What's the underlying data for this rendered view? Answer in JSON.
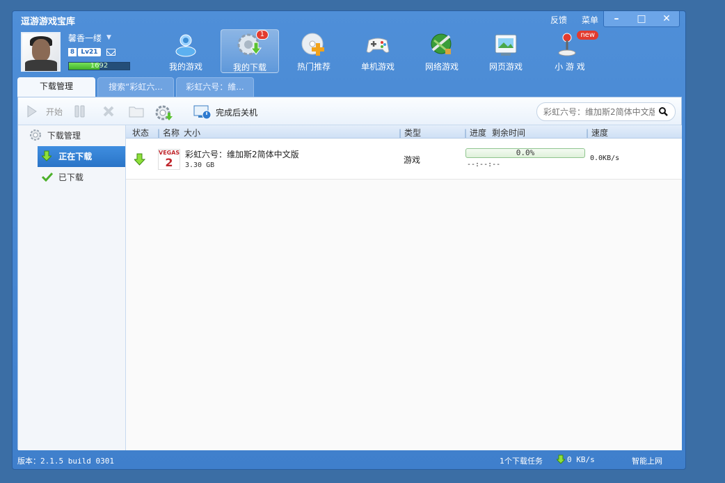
{
  "app": {
    "title": "逗游游戏宝库"
  },
  "titlebar": {
    "feedback": "反馈",
    "menu": "菜单"
  },
  "user": {
    "name": "馨香一缕",
    "level": "Lv21",
    "lv_icon": "8",
    "exp": "1692",
    "exp_progress": 0.5
  },
  "nav": {
    "items": [
      {
        "label": "我的游戏",
        "icon": "my-games-icon"
      },
      {
        "label": "我的下载",
        "icon": "my-downloads-icon",
        "badge": "1"
      },
      {
        "label": "热门推荐",
        "icon": "hot-recommend-icon"
      },
      {
        "label": "单机游戏",
        "icon": "single-player-games-icon"
      },
      {
        "label": "网络游戏",
        "icon": "online-games-icon"
      },
      {
        "label": "网页游戏",
        "icon": "web-games-icon"
      },
      {
        "label": "小 游 戏",
        "icon": "mini-games-icon",
        "badge": "new"
      }
    ]
  },
  "tabs": [
    {
      "label": "下载管理"
    },
    {
      "label": "搜索“彩虹六..."
    },
    {
      "label": "彩虹六号：維..."
    }
  ],
  "toolbar": {
    "start": "开始",
    "shutdown_after": "完成后关机"
  },
  "search": {
    "placeholder": "彩虹六号：维加斯2简体中文版"
  },
  "sidebar": {
    "header": "下载管理",
    "items": [
      {
        "label": "正在下载"
      },
      {
        "label": "已下载"
      }
    ]
  },
  "table": {
    "columns": {
      "status": "状态",
      "name": "名称",
      "size": "大小",
      "type": "类型",
      "progress": "进度",
      "remaining": "剩余时间",
      "speed": "速度"
    },
    "rows": [
      {
        "name": "彩虹六号：维加斯2简体中文版",
        "size": "3.30 GB",
        "type": "游戏",
        "progress": "0.0%",
        "progress_value": 0.0,
        "remaining": "--:--:--",
        "speed": "0.0KB/s",
        "thumb_text": "VEGAS",
        "thumb_num": "2"
      }
    ]
  },
  "status": {
    "version": "版本：2.1.5 build 0301",
    "tasks": "1个下载任务",
    "speed": "0 KB/s",
    "smart": "智能上网"
  },
  "colors": {
    "window": "#4f8fd8",
    "accent": "#2a74c7",
    "progress": "#4cbb3c",
    "badge": "#e23b2f"
  }
}
